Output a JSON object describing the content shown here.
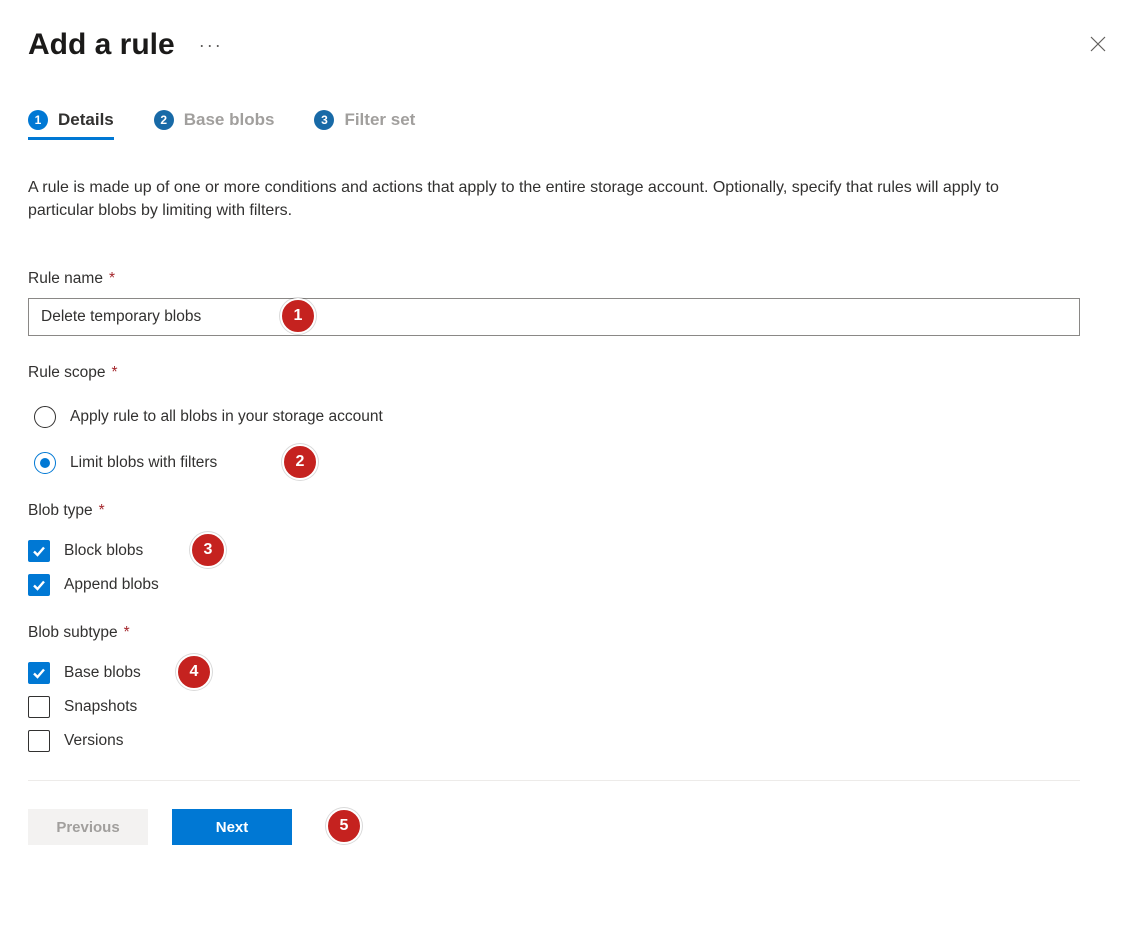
{
  "header": {
    "title": "Add a rule"
  },
  "stepper": {
    "steps": [
      {
        "num": "1",
        "label": "Details"
      },
      {
        "num": "2",
        "label": "Base blobs"
      },
      {
        "num": "3",
        "label": "Filter set"
      }
    ]
  },
  "description": "A rule is made up of one or more conditions and actions that apply to the entire storage account. Optionally, specify that rules will apply to particular blobs by limiting with filters.",
  "fields": {
    "rule_name_label": "Rule name",
    "rule_name_value": "Delete temporary blobs",
    "rule_scope_label": "Rule scope",
    "scope_option_all": "Apply rule to all blobs in your storage account",
    "scope_option_limit": "Limit blobs with filters",
    "blob_type_label": "Blob type",
    "blob_type_block": "Block blobs",
    "blob_type_append": "Append blobs",
    "blob_subtype_label": "Blob subtype",
    "blob_subtype_base": "Base blobs",
    "blob_subtype_snapshots": "Snapshots",
    "blob_subtype_versions": "Versions"
  },
  "footer": {
    "previous_label": "Previous",
    "next_label": "Next"
  },
  "callouts": {
    "c1": "1",
    "c2": "2",
    "c3": "3",
    "c4": "4",
    "c5": "5"
  }
}
